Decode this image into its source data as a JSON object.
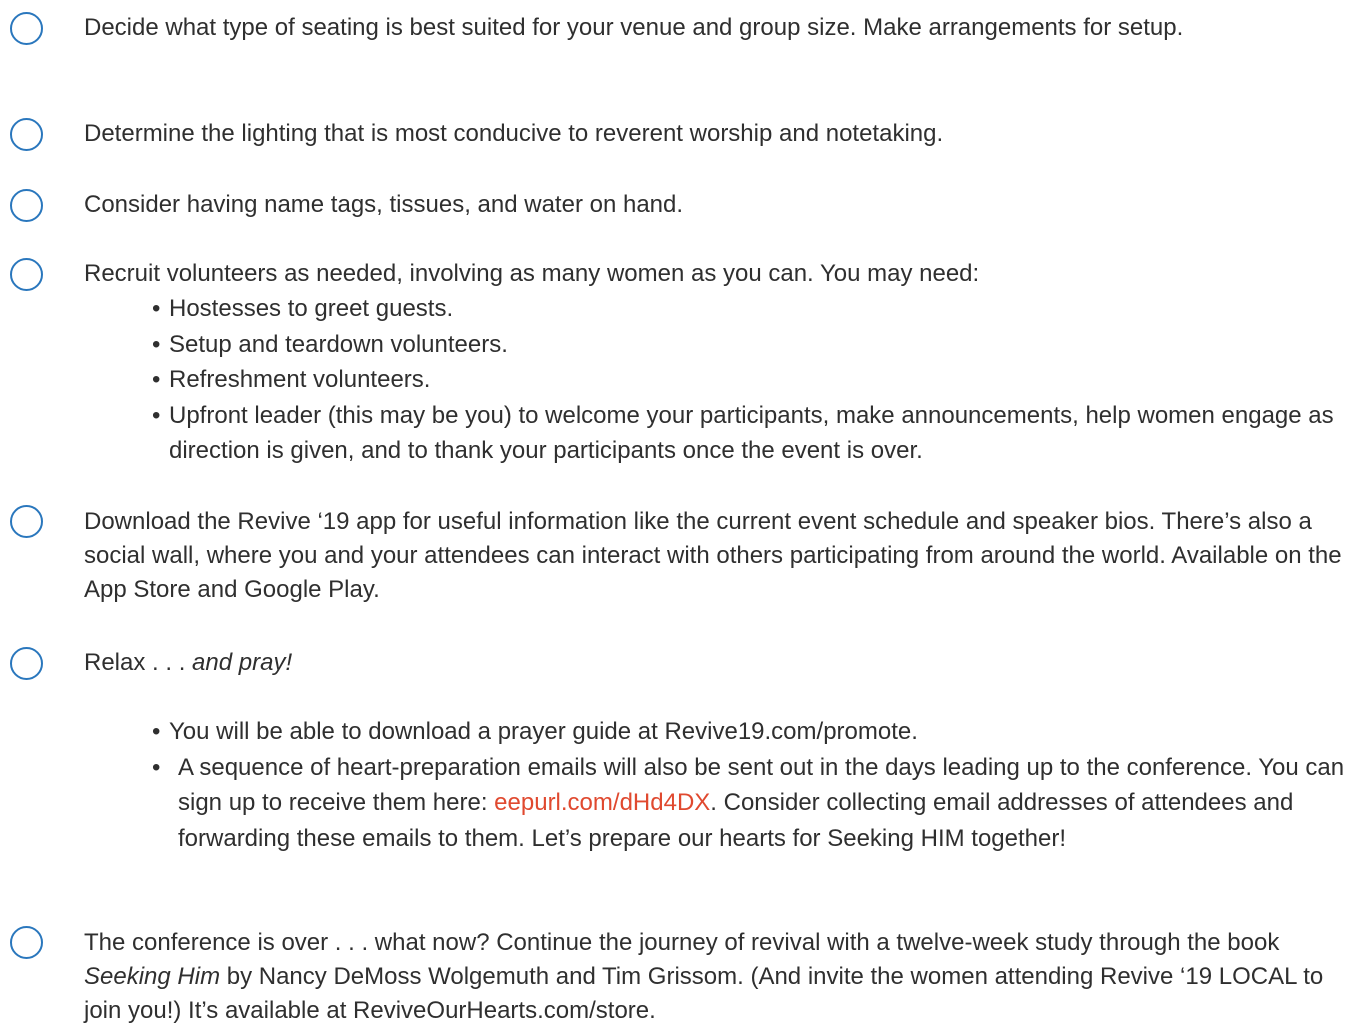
{
  "checklist": {
    "accent_color": "#2a77bd",
    "link_color": "#e0492f",
    "items": [
      {
        "text": "Decide what type of seating is best suited for your venue and group size. Make arrangements for setup."
      },
      {
        "text": "Determine the lighting that is most conducive to reverent worship and notetaking."
      },
      {
        "text": "Consider having name tags, tissues, and water on hand."
      },
      {
        "text": "Recruit volunteers as needed, involving as many women as you can. You may need:",
        "bullets": [
          "Hostesses to greet guests.",
          "Setup and teardown volunteers.",
          "Refreshment volunteers.",
          "Upfront leader (this may be you) to welcome your participants, make announcements, help women engage as direction is given, and to thank your participants once the event is over."
        ]
      },
      {
        "text": "Download the Revive ‘19 app for useful information like the current event schedule and  speaker bios. There’s also a social wall, where you and your attendees can interact with others participating from around the world. Available on the App Store and Google Play."
      },
      {
        "text_prefix": "Relax . . . ",
        "text_emphasis": "and pray!",
        "bullets_simple": [
          "You will be able to download a prayer guide at Revive19.com/promote."
        ],
        "bullet_with_link": {
          "before": "A sequence of heart-preparation emails will also be sent out in the days leading up to the conference. You can sign up to receive them here: ",
          "link": "eepurl.com/dHd4DX",
          "after": ". Consider collecting email addresses of attendees and forwarding these emails to them. Let’s prepare our hearts for Seeking HIM together!"
        }
      },
      {
        "before": "The conference is over . . . what now? Continue the journey of revival with a twelve-week study through the book ",
        "book_title": "Seeking Him",
        "after": " by Nancy DeMoss Wolgemuth and Tim Grissom. (And invite the women attending Revive ‘19 LOCAL to join you!) It’s available at ReviveOurHearts.com/store."
      }
    ]
  }
}
